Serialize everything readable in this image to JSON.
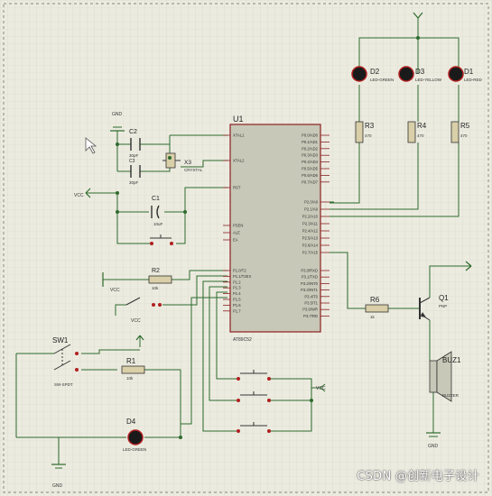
{
  "colors": {
    "wire": "#2d6b2d",
    "body_fill": "#c8c8b8",
    "body_stroke": "#8b2020",
    "led_fill": "#1a1a1a",
    "led_glow": "#b02020",
    "resistor_fill": "#d9cfa8",
    "grid": "#d8d8c8",
    "pin_text": "#333333"
  },
  "mcu": {
    "ref": "U1",
    "part": "AT89C52",
    "left_pins_top": [
      "XTAL1",
      "XTAL2"
    ],
    "rst": "RST",
    "left_pins_mid": [
      "PSEN",
      "ALE",
      "EA"
    ],
    "left_pins_p1": [
      "P1.0/T2",
      "P1.1/T2EX",
      "P1.2",
      "P1.3",
      "P1.4",
      "P1.5",
      "P1.6",
      "P1.7"
    ],
    "right_pins_p0": [
      "P0.0/AD0",
      "P0.1/AD1",
      "P0.2/AD2",
      "P0.3/AD3",
      "P0.4/AD4",
      "P0.5/AD5",
      "P0.6/AD6",
      "P0.7/AD7"
    ],
    "right_pins_p2": [
      "P2.0/A8",
      "P2.1/A9",
      "P2.2/A10",
      "P2.3/A11",
      "P2.4/A12",
      "P2.5/A13",
      "P2.6/A14",
      "P2.7/A15"
    ],
    "right_pins_p3": [
      "P3.0/RXD",
      "P3.1/TXD",
      "P3.2/INT0",
      "P3.3/INT1",
      "P3.4/T0",
      "P3.5/T1",
      "P3.6/WR",
      "P3.7/RD"
    ]
  },
  "components": {
    "c1": {
      "ref": "C1",
      "value": "10uF"
    },
    "c2": {
      "ref": "C2",
      "value": "30pF"
    },
    "c3": {
      "ref": "C3",
      "value": "30pF"
    },
    "x3": {
      "ref": "X3",
      "value": "CRYSTAL"
    },
    "r1": {
      "ref": "R1",
      "value": "10k"
    },
    "r2": {
      "ref": "R2",
      "value": "10k"
    },
    "r3": {
      "ref": "R3",
      "value": "470"
    },
    "r4": {
      "ref": "R4",
      "value": "470"
    },
    "r5": {
      "ref": "R5",
      "value": "470"
    },
    "r6": {
      "ref": "R6",
      "value": "1k"
    },
    "d1": {
      "ref": "D1",
      "value": "LED-RED"
    },
    "d2": {
      "ref": "D2",
      "value": "LED-GREEN"
    },
    "d3": {
      "ref": "D3",
      "value": "LED-YELLOW"
    },
    "d4": {
      "ref": "D4",
      "value": "LED-GREEN"
    },
    "q1": {
      "ref": "Q1",
      "value": "PNP"
    },
    "buz1": {
      "ref": "BUZ1",
      "value": "BUZZER"
    },
    "sw1": {
      "ref": "SW1",
      "value": "SW-SPDT"
    }
  },
  "power": {
    "vcc": "VCC",
    "gnd": "GND"
  },
  "watermark": "CSDN @创新电子设计"
}
